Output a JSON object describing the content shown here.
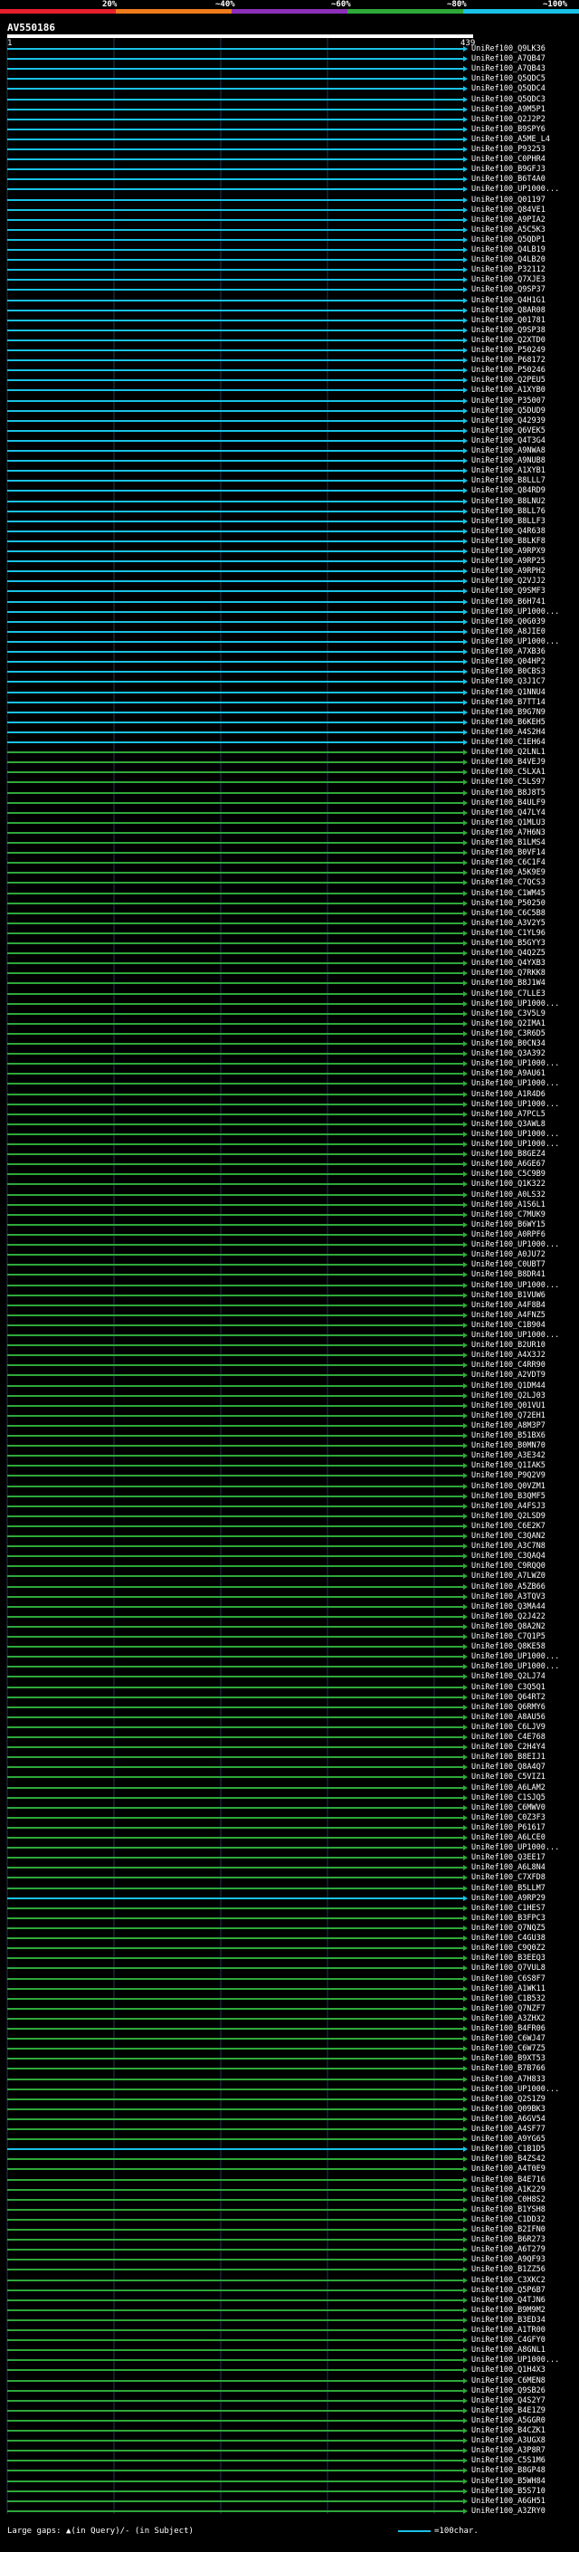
{
  "scale": {
    "labels": [
      "20%",
      "~40%",
      "~60%",
      "~80%",
      "~100%"
    ],
    "colors": [
      "#e8202c",
      "#f07b1c",
      "#8c2fb8",
      "#2ea83a",
      "#19c2e6"
    ]
  },
  "query": {
    "title": "AV550186",
    "start_coord": "1",
    "end_coord": "439",
    "bar_color": "#ffffff"
  },
  "colors": {
    "cyan": "#19c2e6",
    "green": "#2ea83a",
    "grid": "#1f3a55"
  },
  "hits": [
    {
      "label": "UniRef100_Q9LK36",
      "color": "cyan"
    },
    {
      "label": "UniRef100_A7QB47",
      "color": "cyan"
    },
    {
      "label": "UniRef100_A7QB43",
      "color": "cyan"
    },
    {
      "label": "UniRef100_Q5QDC5",
      "color": "cyan"
    },
    {
      "label": "UniRef100_Q5QDC4",
      "color": "cyan"
    },
    {
      "label": "UniRef100_Q5QDC3",
      "color": "cyan"
    },
    {
      "label": "UniRef100_A9M5P1",
      "color": "cyan"
    },
    {
      "label": "UniRef100_Q2J2P2",
      "color": "cyan"
    },
    {
      "label": "UniRef100_B9SPY6",
      "color": "cyan"
    },
    {
      "label": "UniRef100_A5ME_L4",
      "color": "cyan"
    },
    {
      "label": "UniRef100_P93253",
      "color": "cyan"
    },
    {
      "label": "UniRef100_C0PHR4",
      "color": "cyan"
    },
    {
      "label": "UniRef100_B9GFJ3",
      "color": "cyan"
    },
    {
      "label": "UniRef100_B6T4A0",
      "color": "cyan"
    },
    {
      "label": "UniRef100_UP1000...",
      "color": "cyan"
    },
    {
      "label": "UniRef100_Q01197",
      "color": "cyan"
    },
    {
      "label": "UniRef100_Q84VE1",
      "color": "cyan"
    },
    {
      "label": "UniRef100_A9PIA2",
      "color": "cyan"
    },
    {
      "label": "UniRef100_A5C5K3",
      "color": "cyan"
    },
    {
      "label": "UniRef100_Q5QDP1",
      "color": "cyan"
    },
    {
      "label": "UniRef100_Q4LB19",
      "color": "cyan"
    },
    {
      "label": "UniRef100_Q4LB20",
      "color": "cyan"
    },
    {
      "label": "UniRef100_P32112",
      "color": "cyan"
    },
    {
      "label": "UniRef100_Q7XJE3",
      "color": "cyan"
    },
    {
      "label": "UniRef100_Q9SP37",
      "color": "cyan"
    },
    {
      "label": "UniRef100_Q4H1G1",
      "color": "cyan"
    },
    {
      "label": "UniRef100_Q8AR08",
      "color": "cyan"
    },
    {
      "label": "UniRef100_Q01781",
      "color": "cyan"
    },
    {
      "label": "UniRef100_Q9SP38",
      "color": "cyan"
    },
    {
      "label": "UniRef100_Q2XTD0",
      "color": "cyan"
    },
    {
      "label": "UniRef100_P50249",
      "color": "cyan"
    },
    {
      "label": "UniRef100_P68172",
      "color": "cyan"
    },
    {
      "label": "UniRef100_P50246",
      "color": "cyan"
    },
    {
      "label": "UniRef100_Q2PEU5",
      "color": "cyan"
    },
    {
      "label": "UniRef100_A1XYB0",
      "color": "cyan"
    },
    {
      "label": "UniRef100_P35007",
      "color": "cyan"
    },
    {
      "label": "UniRef100_Q5DUD9",
      "color": "cyan"
    },
    {
      "label": "UniRef100_Q42939",
      "color": "cyan"
    },
    {
      "label": "UniRef100_Q6VEK5",
      "color": "cyan"
    },
    {
      "label": "UniRef100_Q4T3G4",
      "color": "cyan"
    },
    {
      "label": "UniRef100_A9NWA8",
      "color": "cyan"
    },
    {
      "label": "UniRef100_A9NUB8",
      "color": "cyan"
    },
    {
      "label": "UniRef100_A1XYB1",
      "color": "cyan"
    },
    {
      "label": "UniRef100_B8LLL7",
      "color": "cyan"
    },
    {
      "label": "UniRef100_Q84RD9",
      "color": "cyan"
    },
    {
      "label": "UniRef100_B8LNU2",
      "color": "cyan"
    },
    {
      "label": "UniRef100_B8LL76",
      "color": "cyan"
    },
    {
      "label": "UniRef100_B8LLF3",
      "color": "cyan"
    },
    {
      "label": "UniRef100_Q4R638",
      "color": "cyan"
    },
    {
      "label": "UniRef100_B8LKF8",
      "color": "cyan"
    },
    {
      "label": "UniRef100_A9RPX9",
      "color": "cyan"
    },
    {
      "label": "UniRef100_A9RP25",
      "color": "cyan"
    },
    {
      "label": "UniRef100_A9RPH2",
      "color": "cyan"
    },
    {
      "label": "UniRef100_Q2VJJ2",
      "color": "cyan"
    },
    {
      "label": "UniRef100_Q9SMF3",
      "color": "cyan"
    },
    {
      "label": "UniRef100_B6H741",
      "color": "cyan"
    },
    {
      "label": "UniRef100_UP1000...",
      "color": "cyan"
    },
    {
      "label": "UniRef100_Q0G039",
      "color": "cyan"
    },
    {
      "label": "UniRef100_A8JIE0",
      "color": "cyan"
    },
    {
      "label": "UniRef100_UP1000...",
      "color": "cyan"
    },
    {
      "label": "UniRef100_A7XB36",
      "color": "cyan"
    },
    {
      "label": "UniRef100_Q04HP2",
      "color": "cyan"
    },
    {
      "label": "UniRef100_B0CBS3",
      "color": "cyan"
    },
    {
      "label": "UniRef100_Q3J1C7",
      "color": "cyan"
    },
    {
      "label": "UniRef100_Q1NNU4",
      "color": "cyan"
    },
    {
      "label": "UniRef100_B7TT14",
      "color": "cyan"
    },
    {
      "label": "UniRef100_B9G7N9",
      "color": "cyan"
    },
    {
      "label": "UniRef100_B6KEH5",
      "color": "cyan"
    },
    {
      "label": "UniRef100_A4S2H4",
      "color": "cyan"
    },
    {
      "label": "UniRef100_C1EH64",
      "color": "cyan"
    },
    {
      "label": "UniRef100_Q2LNL1",
      "color": "green"
    },
    {
      "label": "UniRef100_B4VEJ9",
      "color": "green"
    },
    {
      "label": "UniRef100_C5LXA1",
      "color": "green"
    },
    {
      "label": "UniRef100_C5LS97",
      "color": "green"
    },
    {
      "label": "UniRef100_B8J8T5",
      "color": "green"
    },
    {
      "label": "UniRef100_B4ULF9",
      "color": "green"
    },
    {
      "label": "UniRef100_Q47LY4",
      "color": "green"
    },
    {
      "label": "UniRef100_Q1MLU3",
      "color": "green"
    },
    {
      "label": "UniRef100_A7H6N3",
      "color": "green"
    },
    {
      "label": "UniRef100_B1LMS4",
      "color": "green"
    },
    {
      "label": "UniRef100_B0VF14",
      "color": "green"
    },
    {
      "label": "UniRef100_C6C1F4",
      "color": "green"
    },
    {
      "label": "UniRef100_A5K9E9",
      "color": "green"
    },
    {
      "label": "UniRef100_C7QCS3",
      "color": "green"
    },
    {
      "label": "UniRef100_C1WM45",
      "color": "green"
    },
    {
      "label": "UniRef100_P50250",
      "color": "green"
    },
    {
      "label": "UniRef100_C6C5B8",
      "color": "green"
    },
    {
      "label": "UniRef100_A3V2Y5",
      "color": "green"
    },
    {
      "label": "UniRef100_C1YL96",
      "color": "green"
    },
    {
      "label": "UniRef100_B5GYY3",
      "color": "green"
    },
    {
      "label": "UniRef100_Q4Q2Z5",
      "color": "green"
    },
    {
      "label": "UniRef100_Q4YXB3",
      "color": "green"
    },
    {
      "label": "UniRef100_Q7RKK8",
      "color": "green"
    },
    {
      "label": "UniRef100_B8J1W4",
      "color": "green"
    },
    {
      "label": "UniRef100_C7LLE3",
      "color": "green"
    },
    {
      "label": "UniRef100_UP1000...",
      "color": "green"
    },
    {
      "label": "UniRef100_C3V5L9",
      "color": "green"
    },
    {
      "label": "UniRef100_Q2IMA1",
      "color": "green"
    },
    {
      "label": "UniRef100_C3R6D5",
      "color": "green"
    },
    {
      "label": "UniRef100_B0CN34",
      "color": "green"
    },
    {
      "label": "UniRef100_Q3A392",
      "color": "green"
    },
    {
      "label": "UniRef100_UP1000...",
      "color": "green"
    },
    {
      "label": "UniRef100_A9AU61",
      "color": "green"
    },
    {
      "label": "UniRef100_UP1000...",
      "color": "green"
    },
    {
      "label": "UniRef100_A1R4D6",
      "color": "green"
    },
    {
      "label": "UniRef100_UP1000...",
      "color": "green"
    },
    {
      "label": "UniRef100_A7PCL5",
      "color": "green"
    },
    {
      "label": "UniRef100_Q3AWL8",
      "color": "green"
    },
    {
      "label": "UniRef100_UP1000...",
      "color": "green"
    },
    {
      "label": "UniRef100_UP1000...",
      "color": "green"
    },
    {
      "label": "UniRef100_B8GEZ4",
      "color": "green"
    },
    {
      "label": "UniRef100_A6GE67",
      "color": "green"
    },
    {
      "label": "UniRef100_C5C9B9",
      "color": "green"
    },
    {
      "label": "UniRef100_Q1K322",
      "color": "green"
    },
    {
      "label": "UniRef100_A0LS32",
      "color": "green"
    },
    {
      "label": "UniRef100_A1S6L1",
      "color": "green"
    },
    {
      "label": "UniRef100_C7MUK9",
      "color": "green"
    },
    {
      "label": "UniRef100_B6WY15",
      "color": "green"
    },
    {
      "label": "UniRef100_A0RPF6",
      "color": "green"
    },
    {
      "label": "UniRef100_UP1000...",
      "color": "green"
    },
    {
      "label": "UniRef100_A0JU72",
      "color": "green"
    },
    {
      "label": "UniRef100_C0UBT7",
      "color": "green"
    },
    {
      "label": "UniRef100_B8DR41",
      "color": "green"
    },
    {
      "label": "UniRef100_UP1000...",
      "color": "green"
    },
    {
      "label": "UniRef100_B1VUW6",
      "color": "green"
    },
    {
      "label": "UniRef100_A4F8B4",
      "color": "green"
    },
    {
      "label": "UniRef100_A4FNZ5",
      "color": "green"
    },
    {
      "label": "UniRef100_C1B904",
      "color": "green"
    },
    {
      "label": "UniRef100_UP1000...",
      "color": "green"
    },
    {
      "label": "UniRef100_B2UR10",
      "color": "green"
    },
    {
      "label": "UniRef100_A4X3J2",
      "color": "green"
    },
    {
      "label": "UniRef100_C4RR90",
      "color": "green"
    },
    {
      "label": "UniRef100_A2VDT9",
      "color": "green"
    },
    {
      "label": "UniRef100_Q1DM44",
      "color": "green"
    },
    {
      "label": "UniRef100_Q2LJ03",
      "color": "green"
    },
    {
      "label": "UniRef100_Q01VU1",
      "color": "green"
    },
    {
      "label": "UniRef100_Q72EH1",
      "color": "green"
    },
    {
      "label": "UniRef100_A8M3P7",
      "color": "green"
    },
    {
      "label": "UniRef100_B51BX6",
      "color": "green"
    },
    {
      "label": "UniRef100_B0MN70",
      "color": "green"
    },
    {
      "label": "UniRef100_A3E342",
      "color": "green"
    },
    {
      "label": "UniRef100_Q1IAK5",
      "color": "green"
    },
    {
      "label": "UniRef100_P9Q2V9",
      "color": "green"
    },
    {
      "label": "UniRef100_Q0VZM1",
      "color": "green"
    },
    {
      "label": "UniRef100_B3QMF5",
      "color": "green"
    },
    {
      "label": "UniRef100_A4FSJ3",
      "color": "green"
    },
    {
      "label": "UniRef100_Q2LSD9",
      "color": "green"
    },
    {
      "label": "UniRef100_C6E2K7",
      "color": "green"
    },
    {
      "label": "UniRef100_C3QAN2",
      "color": "green"
    },
    {
      "label": "UniRef100_A3C7N8",
      "color": "green"
    },
    {
      "label": "UniRef100_C3QAQ4",
      "color": "green"
    },
    {
      "label": "UniRef100_C9RQQ0",
      "color": "green"
    },
    {
      "label": "UniRef100_A7LWZ0",
      "color": "green"
    },
    {
      "label": "UniRef100_A5ZB66",
      "color": "green"
    },
    {
      "label": "UniRef100_A3TQV3",
      "color": "green"
    },
    {
      "label": "UniRef100_Q3MA44",
      "color": "green"
    },
    {
      "label": "UniRef100_Q2J422",
      "color": "green"
    },
    {
      "label": "UniRef100_Q8A2N2",
      "color": "green"
    },
    {
      "label": "UniRef100_C7Q1P5",
      "color": "green"
    },
    {
      "label": "UniRef100_Q8KE58",
      "color": "green"
    },
    {
      "label": "UniRef100_UP1000...",
      "color": "green"
    },
    {
      "label": "UniRef100_UP1000...",
      "color": "green"
    },
    {
      "label": "UniRef100_Q2LJ74",
      "color": "green"
    },
    {
      "label": "UniRef100_C3Q5Q1",
      "color": "green"
    },
    {
      "label": "UniRef100_Q64RT2",
      "color": "green"
    },
    {
      "label": "UniRef100_Q6RMY6",
      "color": "green"
    },
    {
      "label": "UniRef100_A8AU56",
      "color": "green"
    },
    {
      "label": "UniRef100_C6LJV9",
      "color": "green"
    },
    {
      "label": "UniRef100_C4E768",
      "color": "green"
    },
    {
      "label": "UniRef100_C2H4Y4",
      "color": "green"
    },
    {
      "label": "UniRef100_B8EIJ1",
      "color": "green"
    },
    {
      "label": "UniRef100_Q8A4Q7",
      "color": "green"
    },
    {
      "label": "UniRef100_C5VIZ1",
      "color": "green"
    },
    {
      "label": "UniRef100_A6LAM2",
      "color": "green"
    },
    {
      "label": "UniRef100_C1SJQ5",
      "color": "green"
    },
    {
      "label": "UniRef100_C6MWV0",
      "color": "green"
    },
    {
      "label": "UniRef100_C0Z3F3",
      "color": "green"
    },
    {
      "label": "UniRef100_P61617",
      "color": "green"
    },
    {
      "label": "UniRef100_A6LCE0",
      "color": "green"
    },
    {
      "label": "UniRef100_UP1000...",
      "color": "green"
    },
    {
      "label": "UniRef100_Q3EE17",
      "color": "green"
    },
    {
      "label": "UniRef100_A6L8N4",
      "color": "green"
    },
    {
      "label": "UniRef100_C7XFD8",
      "color": "green"
    },
    {
      "label": "UniRef100_B5LLM7",
      "color": "green"
    },
    {
      "label": "UniRef100_A9RP29",
      "color": "cyan"
    },
    {
      "label": "UniRef100_C1HES7",
      "color": "green"
    },
    {
      "label": "UniRef100_B3FPC3",
      "color": "green"
    },
    {
      "label": "UniRef100_Q7NQZ5",
      "color": "green"
    },
    {
      "label": "UniRef100_C4GU38",
      "color": "green"
    },
    {
      "label": "UniRef100_C9Q0Z2",
      "color": "green"
    },
    {
      "label": "UniRef100_B3EEQ3",
      "color": "green"
    },
    {
      "label": "UniRef100_Q7VUL8",
      "color": "green"
    },
    {
      "label": "UniRef100_C6S8F7",
      "color": "green"
    },
    {
      "label": "UniRef100_A1WK11",
      "color": "green"
    },
    {
      "label": "UniRef100_C1B532",
      "color": "green"
    },
    {
      "label": "UniRef100_Q7NZF7",
      "color": "green"
    },
    {
      "label": "UniRef100_A3ZHX2",
      "color": "green"
    },
    {
      "label": "UniRef100_B4FR06",
      "color": "green"
    },
    {
      "label": "UniRef100_C6WJ47",
      "color": "green"
    },
    {
      "label": "UniRef100_C6W7Z5",
      "color": "green"
    },
    {
      "label": "UniRef100_B9XT53",
      "color": "green"
    },
    {
      "label": "UniRef100_B7B766",
      "color": "green"
    },
    {
      "label": "UniRef100_A7H833",
      "color": "green"
    },
    {
      "label": "UniRef100_UP1000...",
      "color": "green"
    },
    {
      "label": "UniRef100_Q2S1Z9",
      "color": "green"
    },
    {
      "label": "UniRef100_Q09BK3",
      "color": "green"
    },
    {
      "label": "UniRef100_A6GV54",
      "color": "green"
    },
    {
      "label": "UniRef100_A4SF77",
      "color": "green"
    },
    {
      "label": "UniRef100_A9YG65",
      "color": "green"
    },
    {
      "label": "UniRef100_C1B1D5",
      "color": "cyan"
    },
    {
      "label": "UniRef100_B4ZS42",
      "color": "green"
    },
    {
      "label": "UniRef100_A4T0E9",
      "color": "green"
    },
    {
      "label": "UniRef100_B4E716",
      "color": "green"
    },
    {
      "label": "UniRef100_A1K229",
      "color": "green"
    },
    {
      "label": "UniRef100_C0H8S2",
      "color": "green"
    },
    {
      "label": "UniRef100_B1YSH8",
      "color": "green"
    },
    {
      "label": "UniRef100_C1DD32",
      "color": "green"
    },
    {
      "label": "UniRef100_B2IFN0",
      "color": "green"
    },
    {
      "label": "UniRef100_B6R273",
      "color": "green"
    },
    {
      "label": "UniRef100_A6T279",
      "color": "green"
    },
    {
      "label": "UniRef100_A9QF93",
      "color": "green"
    },
    {
      "label": "UniRef100_B1ZZ56",
      "color": "green"
    },
    {
      "label": "UniRef100_C3XKC2",
      "color": "green"
    },
    {
      "label": "UniRef100_Q5P6B7",
      "color": "green"
    },
    {
      "label": "UniRef100_Q4TJN6",
      "color": "green"
    },
    {
      "label": "UniRef100_B9M9M2",
      "color": "green"
    },
    {
      "label": "UniRef100_B3ED34",
      "color": "green"
    },
    {
      "label": "UniRef100_A1TR00",
      "color": "green"
    },
    {
      "label": "UniRef100_C4GFY0",
      "color": "green"
    },
    {
      "label": "UniRef100_A8GNL1",
      "color": "green"
    },
    {
      "label": "UniRef100_UP1000...",
      "color": "green"
    },
    {
      "label": "UniRef100_Q1H4X3",
      "color": "green"
    },
    {
      "label": "UniRef100_C6MEN8",
      "color": "green"
    },
    {
      "label": "UniRef100_Q9SB26",
      "color": "green"
    },
    {
      "label": "UniRef100_Q4S2Y7",
      "color": "green"
    },
    {
      "label": "UniRef100_B4E1Z9",
      "color": "green"
    },
    {
      "label": "UniRef100_A5GGR0",
      "color": "green"
    },
    {
      "label": "UniRef100_B4CZK1",
      "color": "green"
    },
    {
      "label": "UniRef100_A3UGX8",
      "color": "green"
    },
    {
      "label": "UniRef100_A3P8R7",
      "color": "green"
    },
    {
      "label": "UniRef100_C5S1M6",
      "color": "green"
    },
    {
      "label": "UniRef100_B8GP48",
      "color": "green"
    },
    {
      "label": "UniRef100_B5WH84",
      "color": "green"
    },
    {
      "label": "UniRef100_B5S710",
      "color": "green"
    },
    {
      "label": "UniRef100_A6GH51",
      "color": "green"
    },
    {
      "label": "UniRef100_A3ZRY0",
      "color": "green"
    }
  ],
  "footer": {
    "gaps_text": "Large gaps: ▲(in Query)/- (in Subject)",
    "legend_text": "=100char."
  }
}
